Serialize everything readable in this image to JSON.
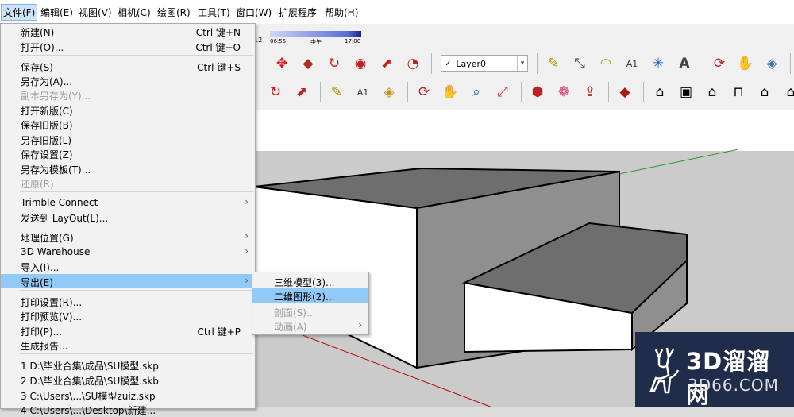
{
  "menubar": {
    "items": [
      "文件(F)",
      "编辑(E)",
      "视图(V)",
      "相机(C)",
      "绘图(R)",
      "工具(T)",
      "窗口(W)",
      "扩展程序",
      "帮助(H)"
    ]
  },
  "shadow": {
    "t_start": "06:55",
    "t_mid": "中午",
    "t_end": "17:00",
    "t_left": "12"
  },
  "layer": {
    "name": "Layer0"
  },
  "file_menu": {
    "items": [
      {
        "label": "新建(N)",
        "shortcut": "Ctrl 键+N"
      },
      {
        "label": "打开(O)...",
        "shortcut": "Ctrl 键+O"
      },
      {
        "label": "保存(S)",
        "shortcut": "Ctrl 键+S"
      },
      {
        "label": "另存为(A)..."
      },
      {
        "label": "副本另存为(Y)...",
        "disabled": true
      },
      {
        "label": "打开新版(C)"
      },
      {
        "label": "保存旧版(B)"
      },
      {
        "label": "另存旧版(L)"
      },
      {
        "label": "保存设置(Z)"
      },
      {
        "label": "另存为模板(T)..."
      },
      {
        "label": "还原(R)",
        "disabled": true
      },
      {
        "label": "Trimble Connect"
      },
      {
        "label": "发送到 LayOut(L)..."
      },
      {
        "label": "地理位置(G)"
      },
      {
        "label": "3D Warehouse"
      },
      {
        "label": "导入(I)..."
      },
      {
        "label": "导出(E)"
      },
      {
        "label": "打印设置(R)..."
      },
      {
        "label": "打印预览(V)..."
      },
      {
        "label": "打印(P)...",
        "shortcut": "Ctrl 键+P"
      },
      {
        "label": "生成报告..."
      },
      {
        "label": "1 D:\\毕业合集\\成品\\SU模型.skp"
      },
      {
        "label": "2 D:\\毕业合集\\成品\\SU模型.skb"
      },
      {
        "label": "3 C:\\Users\\...\\SU模型zuiz.skp"
      },
      {
        "label": "4 C:\\Users\\...\\Desktop\\新建..."
      }
    ]
  },
  "export_menu": {
    "items": [
      {
        "label": "三维模型(3)..."
      },
      {
        "label": "二维图形(2)..."
      },
      {
        "label": "剖面(S)...",
        "disabled": true
      },
      {
        "label": "动画(A)",
        "disabled": true
      }
    ]
  },
  "watermark": {
    "line1": "3D溜溜网",
    "line2": "3D66.COM"
  },
  "colors": {
    "highlight": "#91c9f7",
    "menu_bg": "#f2f2f2",
    "sky": "#ffffff",
    "ground": "#cbcbcb"
  },
  "icons": [
    "move-icon",
    "pushpull-icon",
    "rotate-icon",
    "followme-icon",
    "scale-icon",
    "offset-icon",
    "tape-icon",
    "dimension-icon",
    "protractor-icon",
    "text-icon",
    "axes-icon",
    "3dtext-icon",
    "orbit-icon",
    "pan-icon",
    "zoom-icon",
    "zoom-extents-icon",
    "house-icon"
  ]
}
